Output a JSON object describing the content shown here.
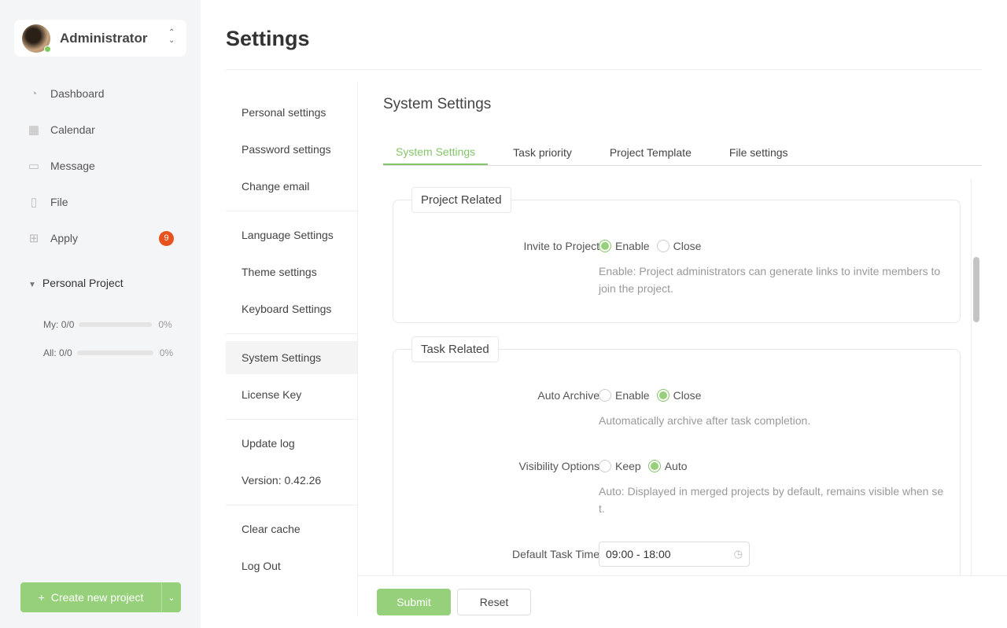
{
  "user": {
    "name": "Administrator",
    "status": "online"
  },
  "nav": [
    {
      "label": "Dashboard",
      "icon": "dashboard-icon"
    },
    {
      "label": "Calendar",
      "icon": "calendar-icon"
    },
    {
      "label": "Message",
      "icon": "message-icon"
    },
    {
      "label": "File",
      "icon": "file-icon"
    },
    {
      "label": "Apply",
      "icon": "apps-icon",
      "badge": "9"
    }
  ],
  "project": {
    "title": "Personal Project",
    "my_label": "My:",
    "my_value": "0/0",
    "my_pct": "0%",
    "all_label": "All:",
    "all_value": "0/0",
    "all_pct": "0%"
  },
  "create_label": "Create new project",
  "page_title": "Settings",
  "menu": [
    "Personal settings",
    "Password settings",
    "Change email",
    "Language Settings",
    "Theme settings",
    "Keyboard Settings",
    "System Settings",
    "License Key",
    "Update log",
    "Version: 0.42.26",
    "Clear cache",
    "Log Out"
  ],
  "section_title": "System Settings",
  "tabs": [
    "System Settings",
    "Task priority",
    "Project Template",
    "File settings"
  ],
  "project_related": {
    "legend": "Project Related",
    "invite": {
      "label": "Invite to Project",
      "options": [
        "Enable",
        "Close"
      ],
      "selected": "Enable",
      "help": "Enable: Project administrators can generate links to invite members to join the project."
    }
  },
  "task_related": {
    "legend": "Task Related",
    "auto_archive": {
      "label": "Auto Archive",
      "options": [
        "Enable",
        "Close"
      ],
      "selected": "Close",
      "help": "Automatically archive after task completion."
    },
    "visibility": {
      "label": "Visibility Options",
      "options": [
        "Keep",
        "Auto"
      ],
      "selected": "Auto",
      "help": "Auto: Displayed in merged projects by default, remains visible when set."
    },
    "task_time": {
      "label": "Default Task Time",
      "value": "09:00 - 18:00"
    }
  },
  "buttons": {
    "submit": "Submit",
    "reset": "Reset"
  },
  "colors": {
    "accent": "#84c56a",
    "badge": "#e8521e"
  }
}
